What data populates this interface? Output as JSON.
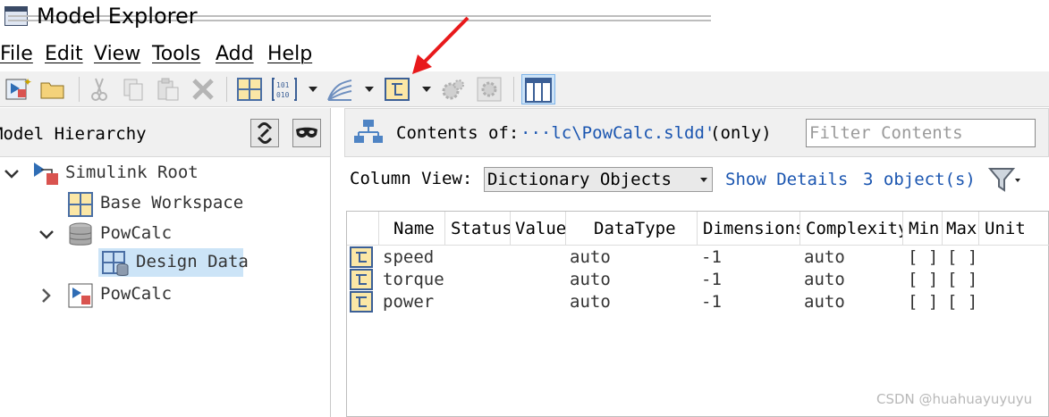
{
  "window": {
    "title": "Model Explorer",
    "app_icon": "model-explorer-icon"
  },
  "menu": [
    {
      "label": "File",
      "key": "F"
    },
    {
      "label": "Edit",
      "key": "E"
    },
    {
      "label": "View",
      "key": "V"
    },
    {
      "label": "Tools",
      "key": "T"
    },
    {
      "label": "Add",
      "key": "A"
    },
    {
      "label": "Help",
      "key": "H"
    }
  ],
  "toolbar": {
    "buttons": [
      "new-model-icon",
      "open-folder-icon",
      "cut-icon",
      "copy-icon",
      "paste-icon",
      "delete-icon",
      "add-grid-icon",
      "add-parameter-icon",
      "add-signal-icon",
      "add-data-object-icon",
      "settings-gear-icon",
      "config-icon",
      "column-view-icon"
    ],
    "active": "column-view-icon"
  },
  "hierarchy": {
    "title": "Model Hierarchy",
    "buttons": [
      "link-icon",
      "mask-icon"
    ],
    "items": [
      {
        "label": "Simulink Root",
        "icon": "simulink-root-icon",
        "expanded": true,
        "level": 0
      },
      {
        "label": "Base Workspace",
        "icon": "workspace-grid-icon",
        "level": 1
      },
      {
        "label": "PowCalc",
        "icon": "dictionary-icon",
        "expanded": true,
        "level": 1
      },
      {
        "label": "Design Data",
        "icon": "design-data-icon",
        "level": 2,
        "selected": true
      },
      {
        "label": "PowCalc",
        "icon": "model-icon",
        "expanded": false,
        "level": 1
      }
    ]
  },
  "contents": {
    "label": "Contents of:",
    "path": "···lc\\PowCalc.sldd'",
    "scope": "(only)",
    "filter_placeholder": "Filter Contents",
    "column_view_label": "Column View:",
    "column_view_value": "Dictionary Objects",
    "show_details": "Show Details",
    "object_count": "3 object(s)"
  },
  "table": {
    "columns": [
      "Name",
      "Status",
      "Value",
      "DataType",
      "Dimensions",
      "Complexity",
      "Min",
      "Max",
      "Unit"
    ],
    "rows": [
      {
        "name": "speed",
        "datatype": "auto",
        "dimensions": "-1",
        "complexity": "auto",
        "min": "[ ]",
        "max": "[ ]"
      },
      {
        "name": "torque",
        "datatype": "auto",
        "dimensions": "-1",
        "complexity": "auto",
        "min": "[ ]",
        "max": "[ ]"
      },
      {
        "name": "power",
        "datatype": "auto",
        "dimensions": "-1",
        "complexity": "auto",
        "min": "[ ]",
        "max": "[ ]"
      }
    ]
  },
  "colors": {
    "accent": "#1a55b0",
    "annotation_arrow": "#e8191b",
    "selection": "#cce4f7"
  },
  "watermark": "CSDN @huahuayuyuyu"
}
